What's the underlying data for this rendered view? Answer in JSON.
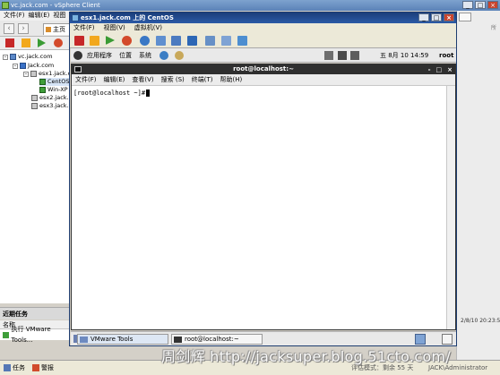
{
  "outer": {
    "title": "vc.jack.com - vSphere Client",
    "menu": [
      "文件(F)",
      "编辑(E)",
      "视图"
    ],
    "tab_label": "主页"
  },
  "tree": {
    "items": [
      {
        "label": "vc.jack.com",
        "icon": "vcenter-icon"
      },
      {
        "label": "Jack.com",
        "icon": "datacenter-icon"
      },
      {
        "label": "esx1.jack.c",
        "icon": "host-icon"
      },
      {
        "label": "CentOS",
        "icon": "vm-icon"
      },
      {
        "label": "Win-XP",
        "icon": "vm-icon"
      },
      {
        "label": "esx2.jack.c",
        "icon": "host-icon"
      },
      {
        "label": "esx3.jack.c",
        "icon": "host-icon"
      }
    ]
  },
  "recent_tasks": {
    "title": "近期任务",
    "column_name": "名称",
    "row": "执行 VMware Tools..."
  },
  "right_strip": {
    "right_col_label": "所",
    "time_snippet": "2/8/10 20:23:5",
    "status_snippet": "JACK\\Administrator"
  },
  "status_bar": {
    "tasks": "任务",
    "alarms": "警报",
    "eval_label": "评估模式：剩余 55 天"
  },
  "console": {
    "title": "esx1.jack.com 上的 CentOS",
    "menu": [
      "文件(F)",
      "视图(V)",
      "虚拟机(V)"
    ]
  },
  "gnome_panel": {
    "menus": [
      "应用程序",
      "位置",
      "系统"
    ],
    "date": "五  8月 10 14:59",
    "user": "root"
  },
  "terminal": {
    "title": "root@localhost:~",
    "menu": [
      "文件(F)",
      "编辑(E)",
      "查看(V)",
      "搜索 (S)",
      "终端(T)",
      "帮助(H)"
    ],
    "prompt": "[root@localhost ~]#"
  },
  "gnome_bottom": {
    "tasks": [
      "VMware Tools",
      "root@localhost:~"
    ]
  },
  "watermark": "周剑辉 http://jacksuper.blog.51cto.com/",
  "colors": {
    "outer_title": "#5b82b8",
    "console_title": "#1b3e7a",
    "terminal_title": "#2f2f2f"
  }
}
